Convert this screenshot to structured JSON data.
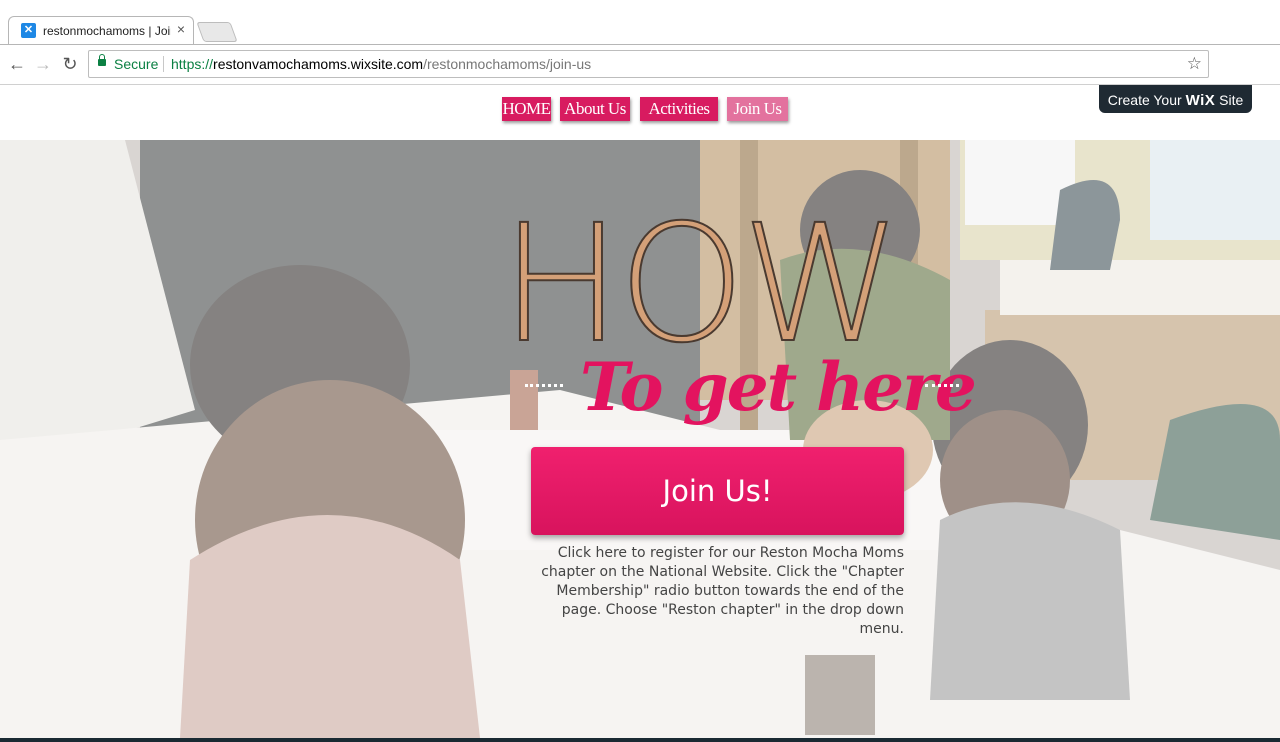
{
  "browser": {
    "tab_title": "restonmochamoms | Join Us",
    "close_glyph": "×",
    "url_scheme": "https://",
    "url_host": "restonvamochamoms.wixsite.com",
    "url_path": "/restonmochamoms/join-us",
    "secure_label": "Secure",
    "icons": [
      "back-icon",
      "forward-icon",
      "reload-icon",
      "lock-icon",
      "star-icon"
    ]
  },
  "nav": {
    "items": [
      {
        "label": "HOME"
      },
      {
        "label": "About Us"
      },
      {
        "label": "Activities"
      },
      {
        "label": "Join Us",
        "active": true
      }
    ]
  },
  "wix_badge": {
    "prefix": "Create Your ",
    "brand": "WiX",
    "suffix": " Site"
  },
  "hero": {
    "heading": "HOW",
    "subheading": "To get here",
    "cta_label": "Join Us!",
    "cta_description": "Click here to register for our Reston Mocha Moms chapter on the National Website. Click the \"Chapter Membership\" radio button towards the end of the page. Choose \"Reston chapter\" in the drop down menu."
  },
  "colors": {
    "brand_pink": "#d81b60",
    "active_pink": "#e3729e",
    "heading_tan": "#d4a078",
    "subheading_pink": "#e3135f",
    "secure_green": "#0b8043"
  }
}
